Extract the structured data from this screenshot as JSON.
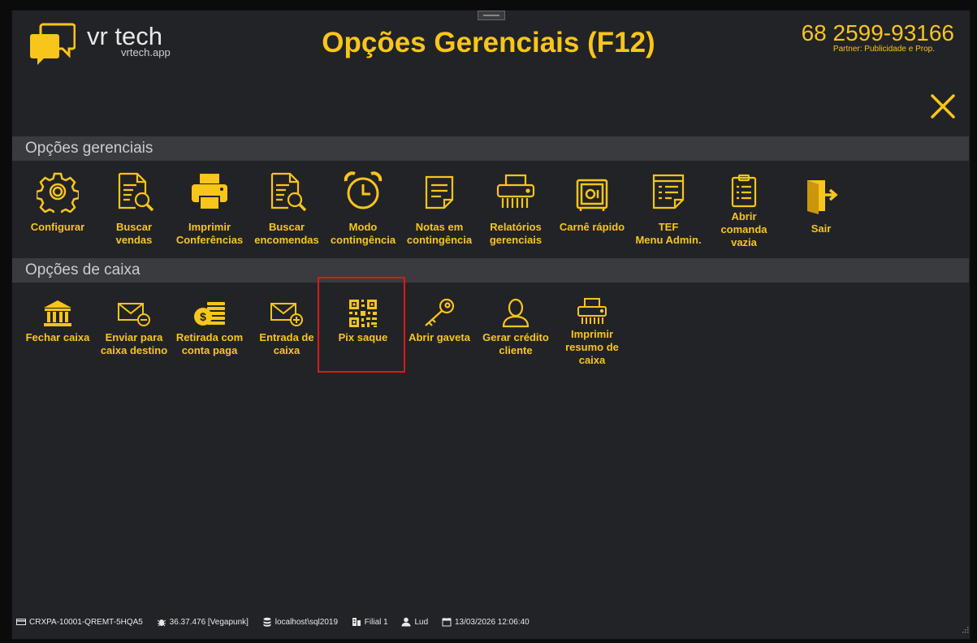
{
  "header": {
    "logo_brand": "vr tech",
    "logo_site": "vrtech.app",
    "title": "Opções Gerenciais (F12)",
    "phone": "68 2599-93166",
    "partner": "Partner: Publicidade e Prop."
  },
  "sections": {
    "management": {
      "title": "Opções gerenciais",
      "items": [
        {
          "label": "Configurar",
          "icon": "gear-icon"
        },
        {
          "label": "Buscar\nvendas",
          "icon": "document-search-icon"
        },
        {
          "label": "Imprimir\nConferências",
          "icon": "printer-icon"
        },
        {
          "label": "Buscar\nencomendas",
          "icon": "document-search-icon"
        },
        {
          "label": "Modo\ncontingência",
          "icon": "alarm-clock-icon"
        },
        {
          "label": "Notas em\ncontingência",
          "icon": "notes-icon"
        },
        {
          "label": "Relatórios\ngerenciais",
          "icon": "shredder-printer-icon"
        },
        {
          "label": "Carnê rápido",
          "icon": "safe-icon"
        },
        {
          "label": "TEF\nMenu Admin.",
          "icon": "list-document-icon"
        },
        {
          "label": "Abrir\ncomanda\nvazia",
          "icon": "clipboard-icon"
        },
        {
          "label": "Sair",
          "icon": "exit-door-icon"
        }
      ]
    },
    "cashier": {
      "title": "Opções de caixa",
      "items": [
        {
          "label": "Fechar caixa",
          "icon": "bank-icon"
        },
        {
          "label": "Enviar para\ncaixa destino",
          "icon": "mail-minus-icon"
        },
        {
          "label": "Retirada com\nconta paga",
          "icon": "coins-icon"
        },
        {
          "label": "Entrada de\ncaixa",
          "icon": "mail-plus-icon"
        },
        {
          "label": "Pix saque",
          "icon": "qr-code-icon"
        },
        {
          "label": "Abrir gaveta",
          "icon": "key-icon"
        },
        {
          "label": "Gerar crédito\ncliente",
          "icon": "user-icon"
        },
        {
          "label": "Imprimir\nresumo de\ncaixa",
          "icon": "shredder-printer-icon"
        }
      ]
    }
  },
  "statusbar": {
    "terminal": "CRXPA-10001-QREMT-5HQA5",
    "version": "36.37.476 [Vegapunk]",
    "database": "localhost\\sql2019",
    "branch": "Filial 1",
    "user": "Lud",
    "datetime": "13/03/2026 12:06:40"
  },
  "colors": {
    "accent": "#f8c51a",
    "background": "#222326",
    "section": "#3a3b3e",
    "highlight": "#e0171b"
  }
}
